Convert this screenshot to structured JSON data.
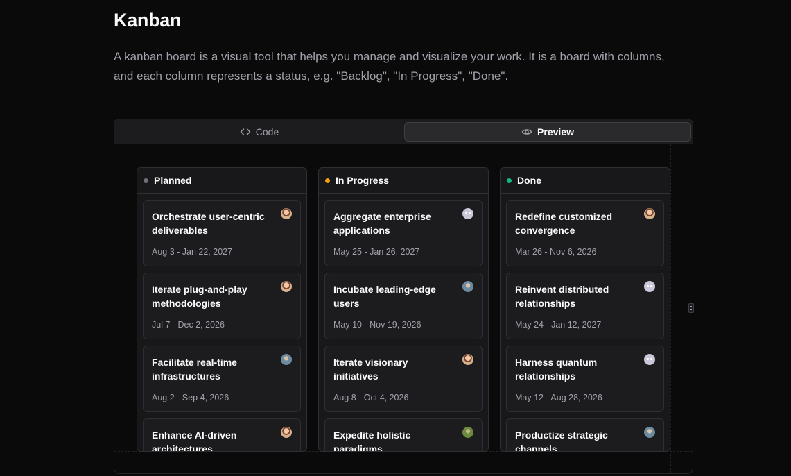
{
  "page": {
    "title": "Kanban",
    "description": "A kanban board is a visual tool that helps you manage and visualize your work. It is a board with columns, and each column represents a status, e.g. \"Backlog\", \"In Progress\", \"Done\"."
  },
  "tabs": [
    {
      "label": "Code",
      "icon": "code-icon",
      "active": false
    },
    {
      "label": "Preview",
      "icon": "eye-icon",
      "active": true
    }
  ],
  "columns": [
    {
      "name": "Planned",
      "color": "#71717a",
      "cards": [
        {
          "title": "Orchestrate user-centric deliverables",
          "date": "Aug 3 - Jan 22, 2027",
          "avatar": "avatar-face"
        },
        {
          "title": "Iterate plug-and-play methodologies",
          "date": "Jul 7 - Dec 2, 2026",
          "avatar": "avatar-face"
        },
        {
          "title": "Facilitate real-time infrastructures",
          "date": "Aug 2 - Sep 4, 2026",
          "avatar": "avatar-photo"
        },
        {
          "title": "Enhance AI-driven architectures",
          "date": "",
          "avatar": "avatar-face"
        }
      ]
    },
    {
      "name": "In Progress",
      "color": "#f59e0b",
      "cards": [
        {
          "title": "Aggregate enterprise applications",
          "date": "May 25 - Jan 26, 2027",
          "avatar": "avatar-ghost"
        },
        {
          "title": "Incubate leading-edge users",
          "date": "May 10 - Nov 19, 2026",
          "avatar": "avatar-photo"
        },
        {
          "title": "Iterate visionary initiatives",
          "date": "Aug 8 - Oct 4, 2026",
          "avatar": "avatar-face"
        },
        {
          "title": "Expedite holistic paradigms",
          "date": "",
          "avatar": "avatar-green"
        }
      ]
    },
    {
      "name": "Done",
      "color": "#10b981",
      "cards": [
        {
          "title": "Redefine customized convergence",
          "date": "Mar 26 - Nov 6, 2026",
          "avatar": "avatar-face"
        },
        {
          "title": "Reinvent distributed relationships",
          "date": "May 24 - Jan 12, 2027",
          "avatar": "avatar-ghost"
        },
        {
          "title": "Harness quantum relationships",
          "date": "May 12 - Aug 28, 2026",
          "avatar": "avatar-ghost"
        },
        {
          "title": "Productize strategic channels",
          "date": "",
          "avatar": "avatar-photo"
        }
      ]
    }
  ]
}
